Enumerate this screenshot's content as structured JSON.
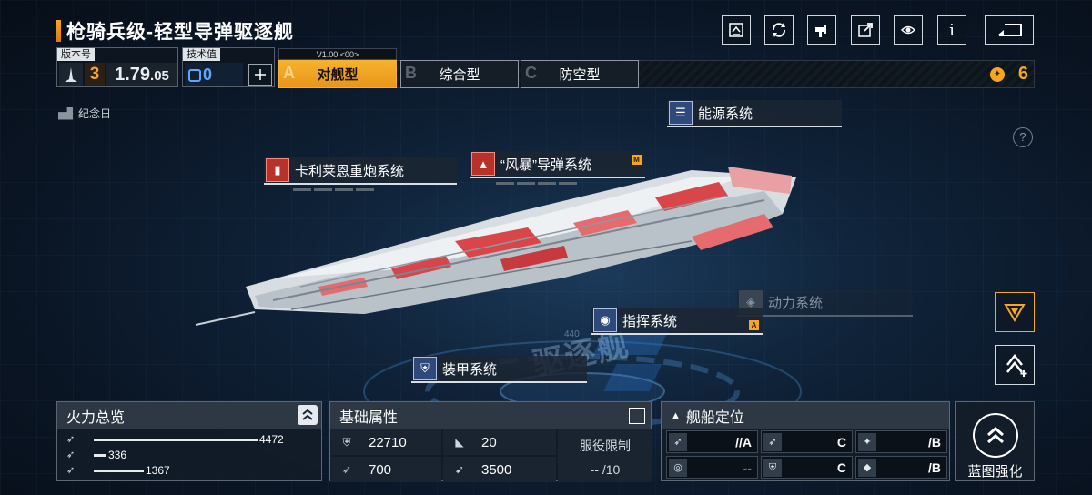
{
  "header": {
    "title": "枪骑兵级-轻型导弹驱逐舰"
  },
  "top_icons": [
    "blueprint-icon",
    "refresh-icon",
    "paint-icon",
    "share-icon",
    "view-icon",
    "info-icon",
    "back-icon"
  ],
  "info_icon_glyph": "i",
  "version": {
    "label": "版本号",
    "tier": "3",
    "value": "1.79",
    "suffix": ".05"
  },
  "tech": {
    "label": "技术值",
    "value": "0"
  },
  "tabs": {
    "version_tag": "V1.00 <00>",
    "items": [
      {
        "letter": "A",
        "label": "对舰型",
        "active": true
      },
      {
        "letter": "B",
        "label": "综合型",
        "active": false
      },
      {
        "letter": "C",
        "label": "防空型",
        "active": false
      }
    ]
  },
  "currency": {
    "value": "6",
    "color": "#f5a623"
  },
  "anniversary": {
    "label": "纪念日"
  },
  "help": {
    "glyph": "?"
  },
  "systems": {
    "energy": "能源系统",
    "heavy_gun": "卡利莱恩重炮系统",
    "missile": "“风暴”导弹系统",
    "missile_badge": "M",
    "power": "动力系统",
    "command": "指挥系统",
    "command_badge": "A",
    "armor": "装甲系统"
  },
  "watermark": {
    "text": "驱逐舰",
    "code": "440"
  },
  "firepower": {
    "title": "火力总览",
    "rows": [
      {
        "value": "4472",
        "fraction": 1.0
      },
      {
        "value": "336",
        "fraction": 0.075
      },
      {
        "value": "1367",
        "fraction": 0.306
      }
    ]
  },
  "attributes": {
    "title": "基础属性",
    "hp": "22710",
    "armor": "20",
    "speed": "700",
    "range": "3500",
    "service_label": "服役限制",
    "service_value": "-- /10"
  },
  "positioning": {
    "title": "舰船定位",
    "cells": [
      {
        "value": "//A",
        "dim": false
      },
      {
        "value": "C",
        "dim": false
      },
      {
        "value": "/B",
        "dim": false
      },
      {
        "value": "--",
        "dim": true
      },
      {
        "value": "C",
        "dim": false
      },
      {
        "value": "/B",
        "dim": false
      }
    ]
  },
  "enhance": {
    "label": "蓝图强化"
  },
  "colors": {
    "accent": "#f5a623",
    "panel": "#2e3844",
    "hull_red": "#d9464a"
  }
}
